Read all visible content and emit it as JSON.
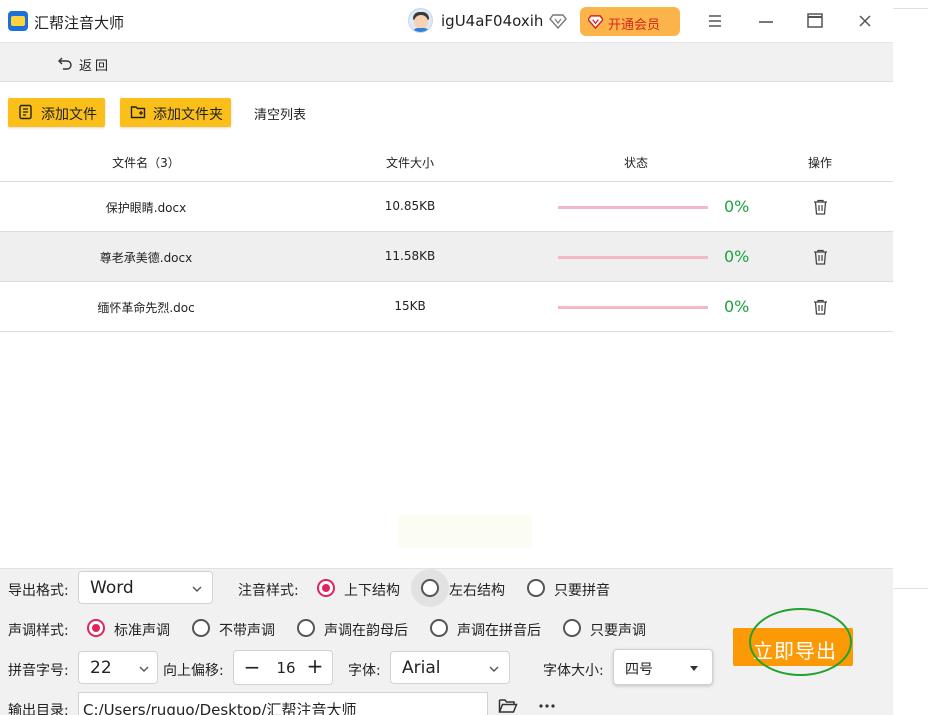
{
  "app": {
    "title": "汇帮注音大师",
    "username": "igU4aF04oxih",
    "vip_label": "开通会员",
    "colors": {
      "accent_yellow": "#fbbf1a",
      "export_orange": "#fb9a06",
      "progress_green": "#19a53e",
      "radio_pink": "#e0245e"
    }
  },
  "nav": {
    "back_label": "返回"
  },
  "toolbar": {
    "add_file_label": "添加文件",
    "add_folder_label": "添加文件夹",
    "clear_label": "清空列表"
  },
  "table": {
    "headers": {
      "name": "文件名（3）",
      "size": "文件大小",
      "status": "状态",
      "action": "操作"
    },
    "rows": [
      {
        "name": "保护眼睛.docx",
        "size": "10.85KB",
        "progress": 0,
        "progress_label": "0%"
      },
      {
        "name": "尊老承美德.docx",
        "size": "11.58KB",
        "progress": 0,
        "progress_label": "0%"
      },
      {
        "name": "缅怀革命先烈.doc",
        "size": "15KB",
        "progress": 0,
        "progress_label": "0%"
      }
    ]
  },
  "settings": {
    "export_format": {
      "label": "导出格式:",
      "value": "Word"
    },
    "annotation_style": {
      "label": "注音样式:",
      "options": [
        "上下结构",
        "左右结构",
        "只要拼音"
      ],
      "selected": "上下结构"
    },
    "tone_style": {
      "label": "声调样式:",
      "options": [
        "标准声调",
        "不带声调",
        "声调在韵母后",
        "声调在拼音后",
        "只要声调"
      ],
      "selected": "标准声调"
    },
    "pinyin_size": {
      "label": "拼音字号:",
      "value": "22"
    },
    "offset": {
      "label": "向上偏移:",
      "minus": "−",
      "value": "16",
      "plus": "+"
    },
    "font": {
      "label": "字体:",
      "value": "Arial"
    },
    "font_size": {
      "label": "字体大小:",
      "value": "四号"
    },
    "output_dir": {
      "label": "输出目录:",
      "value": "C:/Users/ruguo/Desktop/汇帮注音大师"
    },
    "export_label": "立即导出"
  }
}
